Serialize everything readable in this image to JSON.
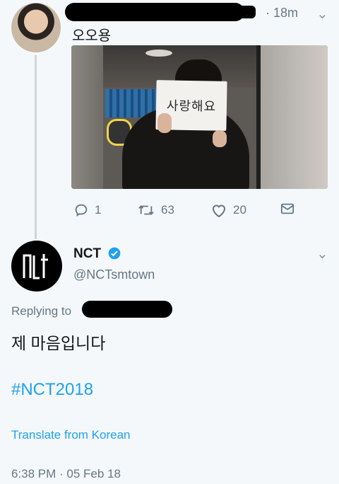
{
  "parent_tweet": {
    "name_tail": "…",
    "time": "· 18m",
    "text": "오오용",
    "image_sign_text": "사랑해요",
    "actions": {
      "replies": "1",
      "retweets": "63",
      "likes": "20"
    }
  },
  "main_tweet": {
    "name": "NCT",
    "handle": "@NCTsmtown",
    "replying_to": "Replying to",
    "text": "제 마음입니다",
    "hashtag": "#NCT2018",
    "translate": "Translate from Korean",
    "timestamp": "6:38 PM · 05 Feb 18"
  },
  "colors": {
    "accent": "#1da1f2",
    "secondary_text": "#657786",
    "background": "#f5f8fa"
  },
  "icons": [
    "reply-icon",
    "retweet-icon",
    "like-icon",
    "share-icon",
    "verified-icon",
    "chevron-down-icon"
  ]
}
